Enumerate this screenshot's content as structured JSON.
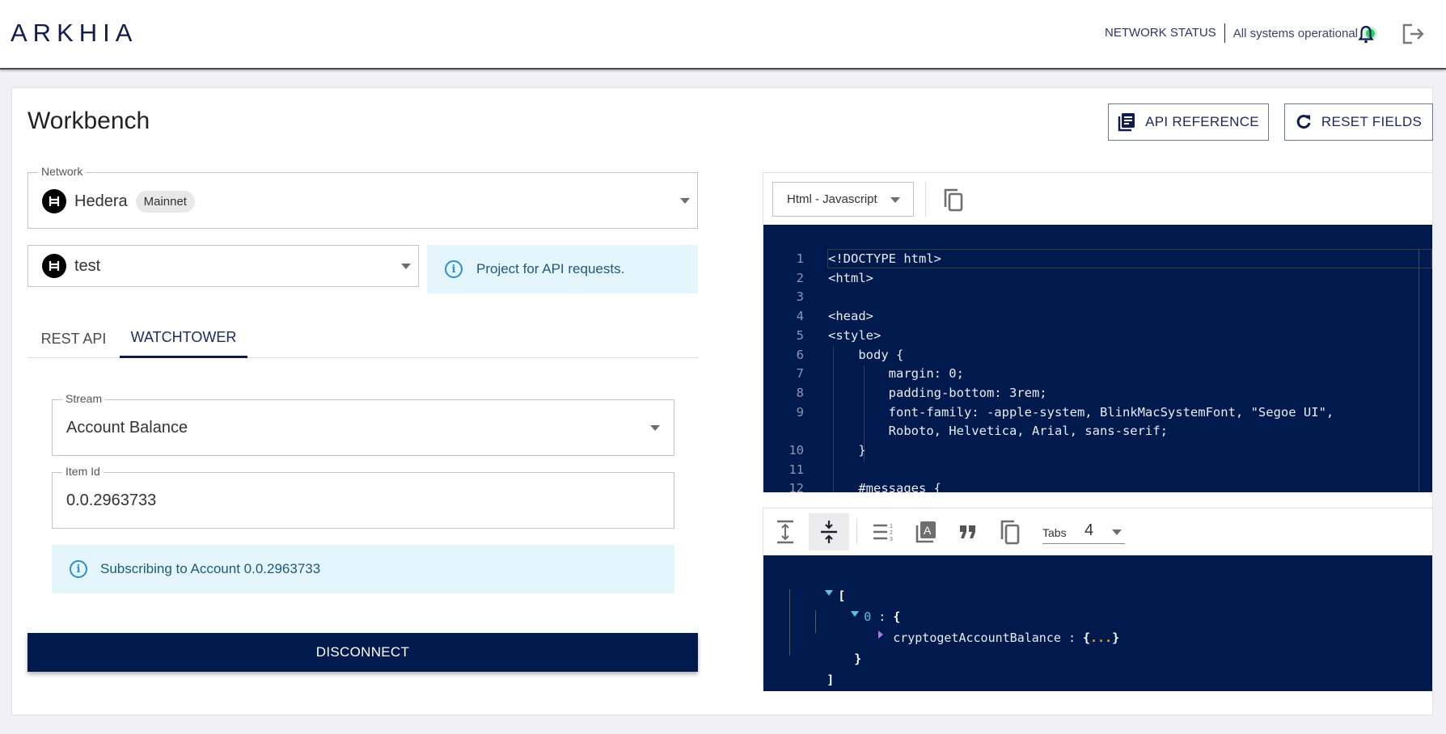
{
  "header": {
    "logo": "ARKHIA",
    "network_status_label": "NETWORK STATUS",
    "network_status_value": "All systems operational",
    "status_color": "#2ecc71"
  },
  "page": {
    "title": "Workbench",
    "api_reference_label": "API REFERENCE",
    "reset_fields_label": "RESET FIELDS"
  },
  "network": {
    "legend": "Network",
    "value": "Hedera",
    "chip": "Mainnet"
  },
  "project": {
    "value": "test",
    "info": "Project for API requests."
  },
  "tabs": [
    {
      "label": "REST API",
      "active": false
    },
    {
      "label": "WATCHTOWER",
      "active": true
    }
  ],
  "stream": {
    "legend": "Stream",
    "value": "Account Balance"
  },
  "item_id": {
    "legend": "Item Id",
    "value": "0.0.2963733"
  },
  "subscription_info": "Subscribing to Account 0.0.2963733",
  "disconnect_label": "DISCONNECT",
  "code_panel": {
    "language": "Html - Javascript",
    "lines": [
      {
        "n": "1",
        "text": "<!DOCTYPE html>"
      },
      {
        "n": "2",
        "text": "<html>"
      },
      {
        "n": "3",
        "text": ""
      },
      {
        "n": "4",
        "text": "<head>"
      },
      {
        "n": "5",
        "text": "<style>"
      },
      {
        "n": "6",
        "text": "    body {"
      },
      {
        "n": "7",
        "text": "        margin: 0;"
      },
      {
        "n": "8",
        "text": "        padding-bottom: 3rem;"
      },
      {
        "n": "9",
        "text": "        font-family: -apple-system, BlinkMacSystemFont, \"Segoe UI\","
      },
      {
        "n": "",
        "text": "        Roboto, Helvetica, Arial, sans-serif;"
      },
      {
        "n": "10",
        "text": "    }"
      },
      {
        "n": "11",
        "text": ""
      },
      {
        "n": "12",
        "text": "    #messages {"
      }
    ]
  },
  "json_panel": {
    "tabs_label": "Tabs",
    "tabs_value": "4",
    "tree": {
      "open_bracket": "[",
      "index_key": "0",
      "colon": ":",
      "open_brace": "{",
      "child_key": "cryptogetAccountBalance",
      "collapsed_open": "{",
      "collapsed_dots": "...",
      "collapsed_close": "}",
      "close_brace": "}",
      "close_bracket": "]"
    }
  }
}
